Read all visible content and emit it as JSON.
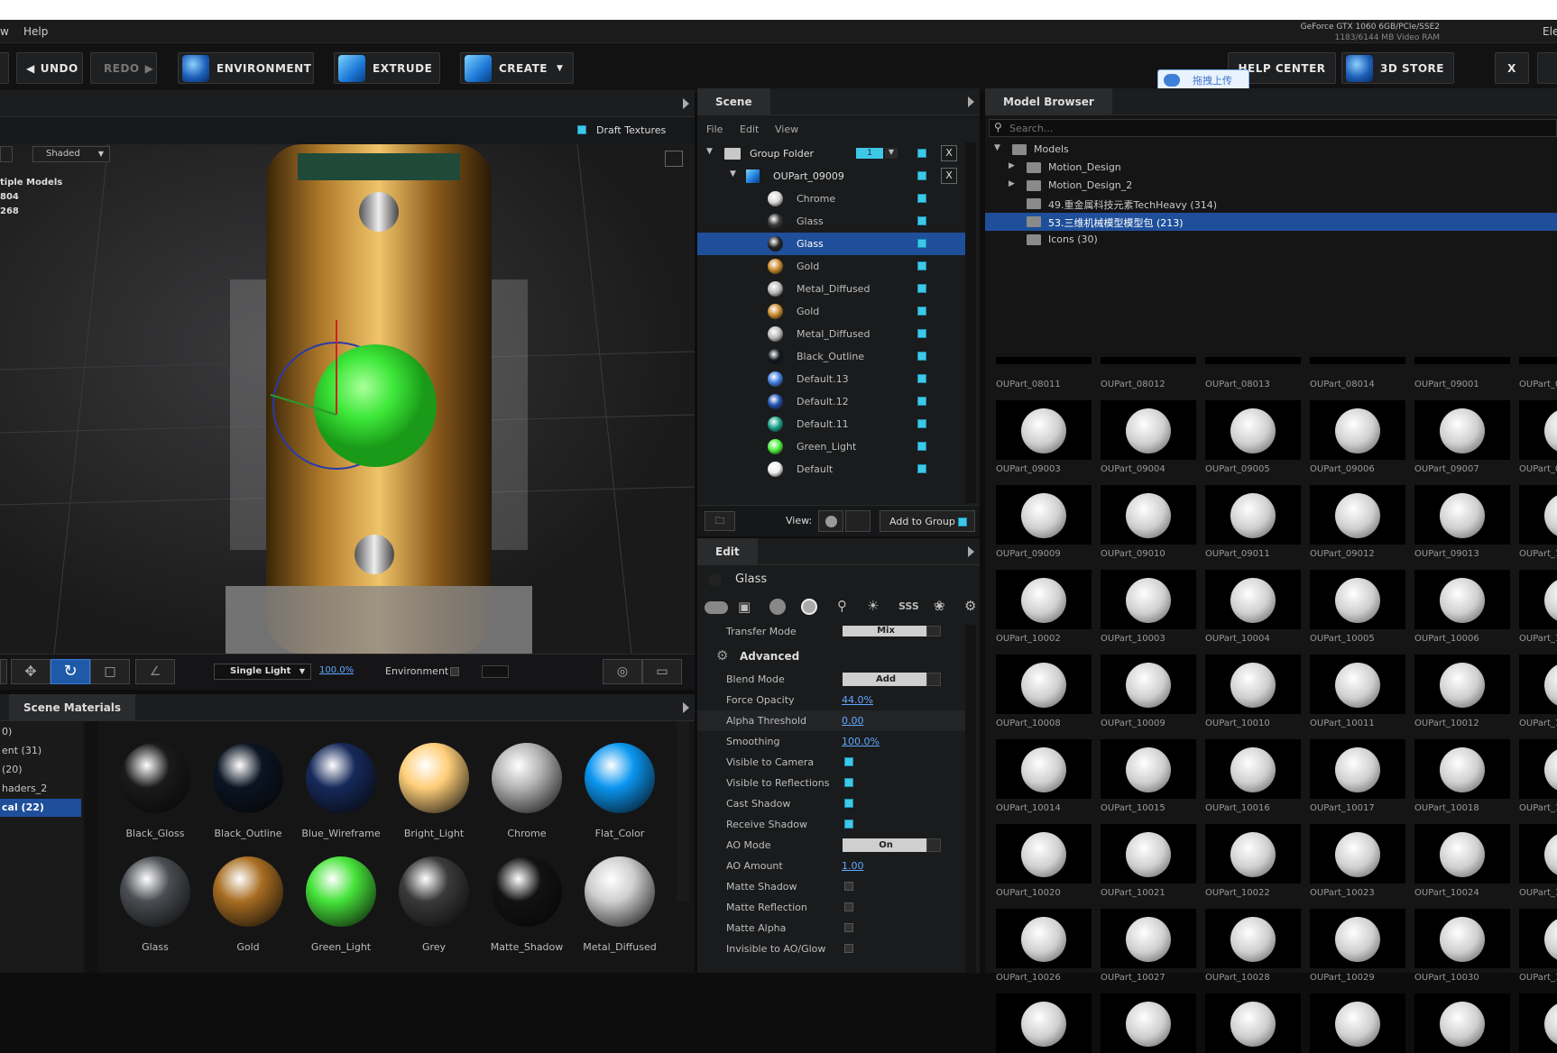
{
  "menu": {
    "item_w": "w",
    "help": "Help"
  },
  "gpu": {
    "name": "GeForce GTX 1060 6GB/PCIe/SSE2",
    "ram": "1183/6144 MB Video RAM",
    "right_cut": "Ele"
  },
  "toolbar": {
    "undo": "UNDO",
    "redo": "REDO",
    "environment": "ENVIRONMENT",
    "extrude": "EXTRUDE",
    "create": "CREATE",
    "help_center": "HELP CENTER",
    "store": "3D STORE",
    "close": "X",
    "upload": "拖拽上传"
  },
  "viewport": {
    "draft_textures": "Draft Textures",
    "shading": "Shaded",
    "info": [
      "tiple Models",
      "804",
      "268"
    ],
    "light_mode": "Single Light",
    "light_pct": "100.0%",
    "environment_label": "Environment"
  },
  "scene": {
    "tab": "Scene",
    "menu": [
      "File",
      "Edit",
      "View"
    ],
    "group_folder": "Group Folder",
    "group_count": "1",
    "part": "OUPart_09009",
    "materials": [
      {
        "name": "Chrome",
        "color": "#d8d8d8"
      },
      {
        "name": "Glass",
        "color": "#3a3a3a"
      },
      {
        "name": "Glass",
        "color": "#222222",
        "selected": true
      },
      {
        "name": "Gold",
        "color": "#c98a2e"
      },
      {
        "name": "Metal_Diffused",
        "color": "#bdbdbd"
      },
      {
        "name": "Gold",
        "color": "#c98a2e"
      },
      {
        "name": "Metal_Diffused",
        "color": "#bdbdbd"
      },
      {
        "name": "Black_Outline",
        "color": "#101820"
      },
      {
        "name": "Default.13",
        "color": "#3f7fe0"
      },
      {
        "name": "Default.12",
        "color": "#1f4fb0"
      },
      {
        "name": "Default.11",
        "color": "#1aa38a"
      },
      {
        "name": "Green_Light",
        "color": "#4df03a"
      },
      {
        "name": "Default",
        "color": "#eeeeee"
      }
    ],
    "view_label": "View:",
    "add_to_group": "Add to Group"
  },
  "edit": {
    "tab": "Edit",
    "material_name": "Glass",
    "transfer_mode": "Transfer Mode",
    "transfer_value": "Mix",
    "section": "Advanced",
    "props": [
      {
        "label": "Blend Mode",
        "kind": "dd",
        "value": "Add"
      },
      {
        "label": "Force Opacity",
        "kind": "val",
        "value": "44.0%"
      },
      {
        "label": "Alpha Threshold",
        "kind": "val",
        "value": "0.00"
      },
      {
        "label": "Smoothing",
        "kind": "val",
        "value": "100.0%"
      },
      {
        "label": "Visible to Camera",
        "kind": "chk",
        "value": "on"
      },
      {
        "label": "Visible to Reflections",
        "kind": "chk",
        "value": "on"
      },
      {
        "label": "Cast Shadow",
        "kind": "chk",
        "value": "on"
      },
      {
        "label": "Receive Shadow",
        "kind": "chk",
        "value": "on"
      },
      {
        "label": "AO Mode",
        "kind": "dd",
        "value": "On"
      },
      {
        "label": "AO Amount",
        "kind": "val",
        "value": "1.00"
      },
      {
        "label": "Matte Shadow",
        "kind": "chk",
        "value": "off"
      },
      {
        "label": "Matte Reflection",
        "kind": "chk",
        "value": "off"
      },
      {
        "label": "Matte Alpha",
        "kind": "chk",
        "value": "off"
      },
      {
        "label": "Invisible to AO/Glow",
        "kind": "chk",
        "value": "off"
      }
    ]
  },
  "browser": {
    "tab": "Model Browser",
    "search_placeholder": "Search...",
    "tree": [
      {
        "label": "Models",
        "depth": 0,
        "arrow": "down"
      },
      {
        "label": "Motion_Design",
        "depth": 1,
        "arrow": "right"
      },
      {
        "label": "Motion_Design_2",
        "depth": 1,
        "arrow": "right"
      },
      {
        "label": "49.重金属科技元素TechHeavy (314)",
        "depth": 1,
        "arrow": ""
      },
      {
        "label": "53.三维机械模型模型包 (213)",
        "depth": 1,
        "arrow": "",
        "selected": true
      },
      {
        "label": "Icons (30)",
        "depth": 1,
        "arrow": ""
      }
    ],
    "top_labels": [
      "OUPart_08011",
      "OUPart_08012",
      "OUPart_08013",
      "OUPart_08014",
      "OUPart_09001",
      "OUPart_0"
    ],
    "rows": [
      [
        "OUPart_09003",
        "OUPart_09004",
        "OUPart_09005",
        "OUPart_09006",
        "OUPart_09007",
        "OUPart_0"
      ],
      [
        "OUPart_09009",
        "OUPart_09010",
        "OUPart_09011",
        "OUPart_09012",
        "OUPart_09013",
        "OUPart_1"
      ],
      [
        "OUPart_10002",
        "OUPart_10003",
        "OUPart_10004",
        "OUPart_10005",
        "OUPart_10006",
        "OUPart_1"
      ],
      [
        "OUPart_10008",
        "OUPart_10009",
        "OUPart_10010",
        "OUPart_10011",
        "OUPart_10012",
        "OUPart_1"
      ],
      [
        "OUPart_10014",
        "OUPart_10015",
        "OUPart_10016",
        "OUPart_10017",
        "OUPart_10018",
        "OUPart_1"
      ],
      [
        "OUPart_10020",
        "OUPart_10021",
        "OUPart_10022",
        "OUPart_10023",
        "OUPart_10024",
        "OUPart_1"
      ],
      [
        "OUPart_10026",
        "OUPart_10027",
        "OUPart_10028",
        "OUPart_10029",
        "OUPart_10030",
        "OUPart_1"
      ],
      [
        "",
        "",
        "",
        "",
        "",
        ""
      ]
    ]
  },
  "materials_panel": {
    "tab": "Scene Materials",
    "categories": [
      {
        "label": "0)"
      },
      {
        "label": "ent (31)"
      },
      {
        "label": "(20)"
      },
      {
        "label": "haders_2"
      },
      {
        "label": "cal (22)",
        "selected": true
      }
    ],
    "items": [
      {
        "name": "Black_Gloss",
        "color": "#1a1a1a"
      },
      {
        "name": "Black_Outline",
        "color": "#0b1422"
      },
      {
        "name": "Blue_Wireframe",
        "color": "#16295a"
      },
      {
        "name": "Bright_Light",
        "color": "#ffcf7a"
      },
      {
        "name": "Chrome",
        "color": "#b5b5b5"
      },
      {
        "name": "Flat_Color",
        "color": "#0a96f0"
      },
      {
        "name": "Glass",
        "color": "#4a4d52"
      },
      {
        "name": "Gold",
        "color": "#a86d22"
      },
      {
        "name": "Green_Light",
        "color": "#46e33a"
      },
      {
        "name": "Grey",
        "color": "#3a3a3a"
      },
      {
        "name": "Matte_Shadow",
        "color": "#121212"
      },
      {
        "name": "Metal_Diffused",
        "color": "#cfcfcf"
      }
    ]
  }
}
